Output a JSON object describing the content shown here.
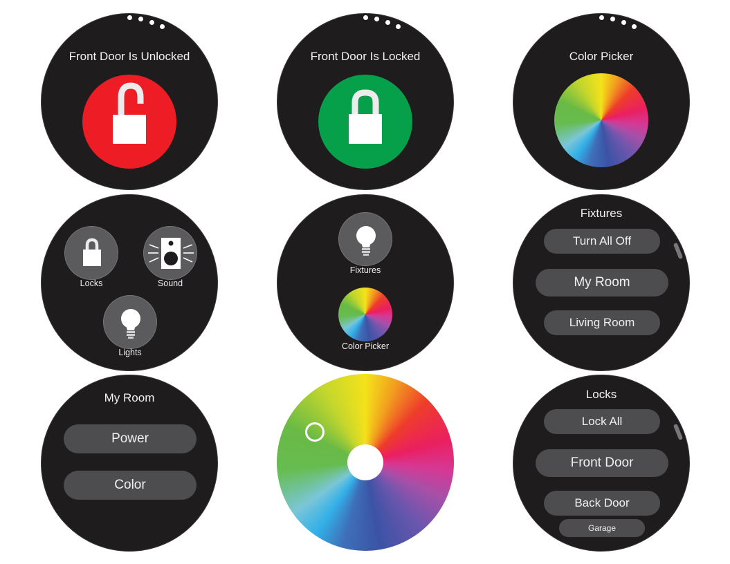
{
  "unlocked_screen": {
    "title": "Front Door Is Unlocked",
    "accent": "#ee1c25",
    "icon": "open-padlock-icon"
  },
  "locked_screen": {
    "title": "Front Door Is Locked",
    "accent": "#06a04a",
    "icon": "closed-padlock-icon"
  },
  "color_picker_screen": {
    "title": "Color Picker"
  },
  "home_menu": {
    "items": [
      {
        "label": "Locks",
        "icon": "padlock-icon"
      },
      {
        "label": "Sound",
        "icon": "speaker-icon"
      },
      {
        "label": "Lights",
        "icon": "lightbulb-icon"
      }
    ]
  },
  "lights_menu": {
    "items": [
      {
        "label": "Fixtures",
        "icon": "lightbulb-icon"
      },
      {
        "label": "Color Picker",
        "icon": "color-wheel-icon"
      }
    ]
  },
  "fixtures_list": {
    "title": "Fixtures",
    "items": [
      "Turn All Off",
      "My Room",
      "Living Room"
    ]
  },
  "my_room_screen": {
    "title": "My Room",
    "items": [
      "Power",
      "Color"
    ]
  },
  "locks_list": {
    "title": "Locks",
    "items": [
      "Lock All",
      "Front Door",
      "Back Door",
      "Garage"
    ]
  }
}
